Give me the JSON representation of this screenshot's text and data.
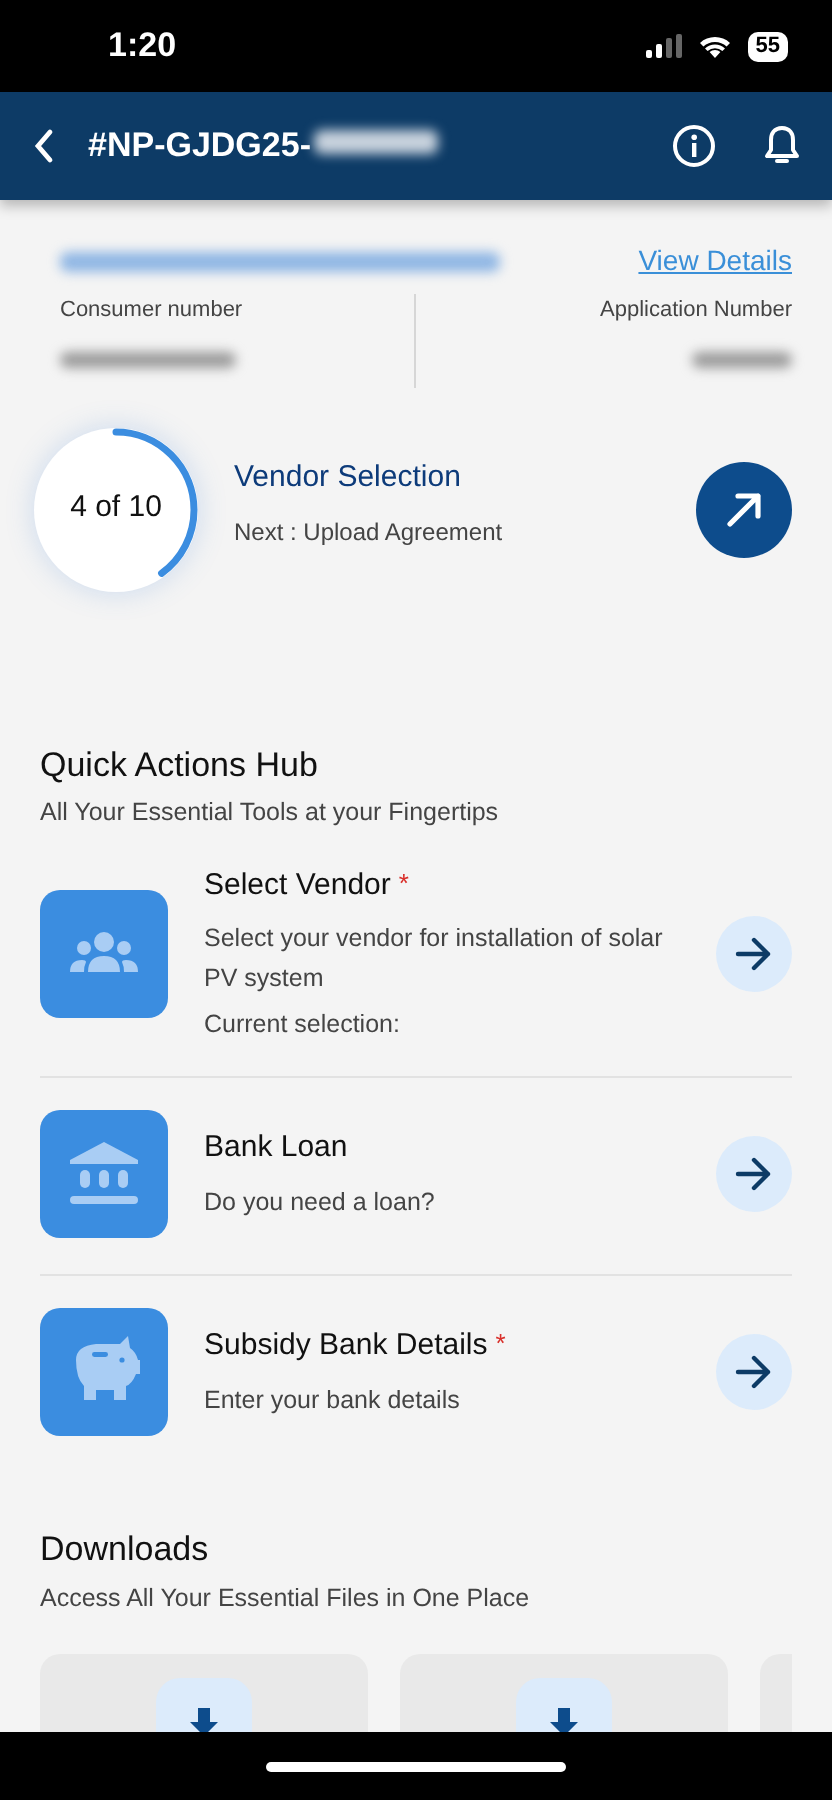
{
  "status_bar": {
    "time": "1:20",
    "battery": "55"
  },
  "header": {
    "title": "#NP-GJDG25-"
  },
  "summary": {
    "link": "View Details",
    "fields": [
      {
        "label": "Consumer number"
      },
      {
        "label": "Application Number"
      }
    ]
  },
  "progress": {
    "count": "4 of 10",
    "level": 0.4,
    "stage": "Vendor Selection",
    "next": "Next : Upload Agreement"
  },
  "quick_actions": {
    "title": "Quick Actions Hub",
    "subtitle": "All Your Essential Tools at your Fingertips",
    "items": [
      {
        "kind": "people",
        "title": "Select Vendor",
        "required_mark": "*",
        "lines": [
          "Select your vendor for installation of solar PV system",
          "Current selection:"
        ]
      },
      {
        "kind": "bank",
        "title": "Bank Loan",
        "lines": [
          "Do you need a loan?"
        ]
      },
      {
        "kind": "piggy",
        "title": "Subsidy Bank Details",
        "required_mark": "*",
        "lines": [
          "Enter your bank details"
        ]
      }
    ]
  },
  "downloads": {
    "title": "Downloads",
    "subtitle": "Access All Your Essential Files in One Place",
    "cards": [
      {
        "kind": "download"
      },
      {
        "kind": "download"
      },
      {
        "kind": "blank"
      }
    ]
  }
}
